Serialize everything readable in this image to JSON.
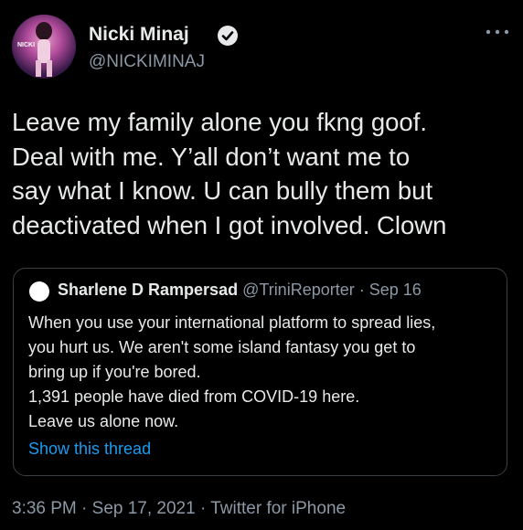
{
  "tweet": {
    "author_name": "Nicki Minaj",
    "author_handle": "@NICKIMINAJ",
    "text_lines": [
      "Leave my family alone you fkng goof.",
      "Deal with me. Y’all don’t want me to",
      "say what I know. U can bully them but",
      "deactivated when I got involved. Clown"
    ],
    "timestamp": "3:36 PM · Sep 17, 2021 · Twitter for iPhone",
    "avatar_text": "NICKI"
  },
  "quote": {
    "author_name": "Sharlene D Rampersad",
    "meta": "@TriniReporter · Sep 16",
    "text_lines": [
      "When you use your international platform to spread lies,",
      "you hurt us. We aren't some island fantasy you get to",
      "bring up if you're bored.",
      "1,391 people have died from COVID-19 here.",
      "Leave us alone now."
    ],
    "show_thread_label": "Show this thread"
  },
  "icons": {
    "verified": "verified-badge-icon",
    "more": "more-options-icon"
  },
  "colors": {
    "background": "#000000",
    "text": "#e7e9ea",
    "secondary": "#8b98a5",
    "link": "#1d9bf0",
    "border": "#3a3f44"
  }
}
